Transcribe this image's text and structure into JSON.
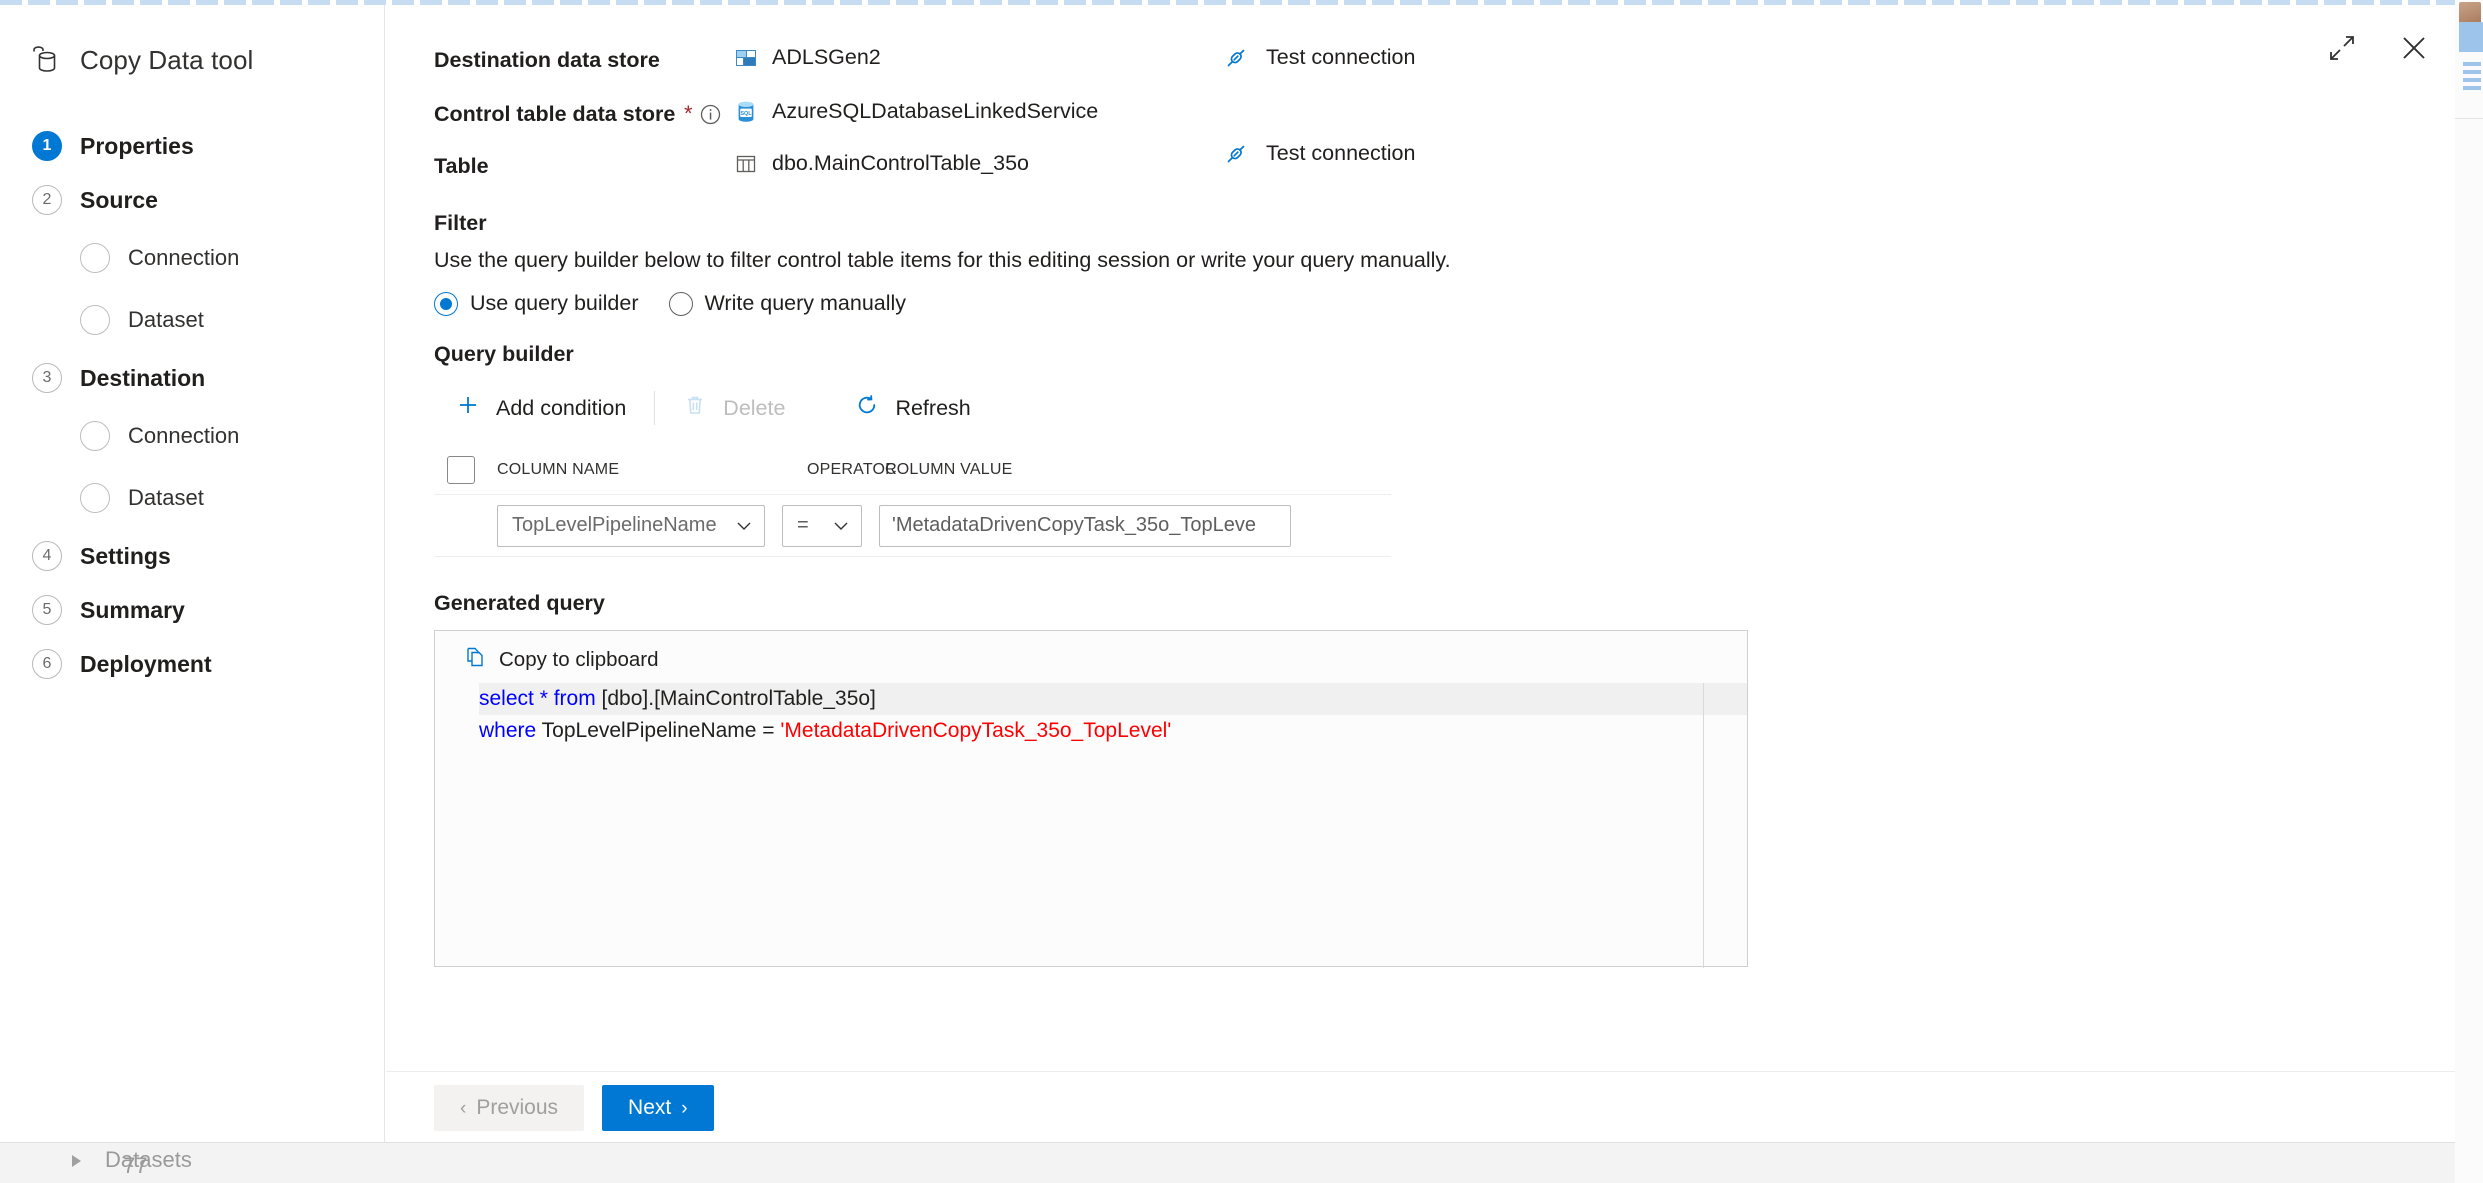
{
  "window": {
    "title": "Copy Data tool",
    "tool_icon": "database-stack-icon",
    "maximize_icon": "expand-diagonal-icon",
    "close_icon": "close-icon"
  },
  "sidebar": {
    "steps": [
      {
        "number": "1",
        "label": "Properties",
        "active": true,
        "substeps": []
      },
      {
        "number": "2",
        "label": "Source",
        "active": false,
        "substeps": [
          "Connection",
          "Dataset"
        ]
      },
      {
        "number": "3",
        "label": "Destination",
        "active": false,
        "substeps": [
          "Connection",
          "Dataset"
        ]
      },
      {
        "number": "4",
        "label": "Settings",
        "active": false,
        "substeps": []
      },
      {
        "number": "5",
        "label": "Summary",
        "active": false,
        "substeps": []
      },
      {
        "number": "6",
        "label": "Deployment",
        "active": false,
        "substeps": []
      }
    ]
  },
  "background": {
    "peek_row_label": "Datasets",
    "peek_row_count": "77",
    "peek_row_chevron": "chevron-right-icon"
  },
  "form": {
    "destination": {
      "label": "Destination data store",
      "value": "ADLSGen2",
      "icon": "adls-gen2-icon",
      "test_connection": "Test connection",
      "test_connection_icon": "plug-connection-icon"
    },
    "control_table_store": {
      "label": "Control table data store",
      "value": "AzureSQLDatabaseLinkedService",
      "icon": "azure-sql-database-icon",
      "required_marker": "*",
      "info_icon": "info-circle-icon",
      "test_connection": "Test connection",
      "test_connection_icon": "plug-connection-icon"
    },
    "table": {
      "label": "Table",
      "value": "dbo.MainControlTable_35o",
      "icon": "table-icon"
    }
  },
  "filter": {
    "heading": "Filter",
    "description": "Use the query builder below to filter control table items for this editing session or write your query manually.",
    "options": [
      {
        "label": "Use query builder",
        "selected": true
      },
      {
        "label": "Write query manually",
        "selected": false
      }
    ]
  },
  "query_builder": {
    "heading": "Query builder",
    "toolbar": {
      "add_condition": "Add condition",
      "add_condition_icon": "plus-icon",
      "delete": "Delete",
      "delete_icon": "trash-icon",
      "delete_disabled": true,
      "refresh": "Refresh",
      "refresh_icon": "refresh-icon"
    },
    "columns": [
      "COLUMN NAME",
      "OPERATOR",
      "COLUMN VALUE"
    ],
    "rows": [
      {
        "column_name": "TopLevelPipelineName",
        "operator": "=",
        "column_value": "'MetadataDrivenCopyTask_35o_TopLeve"
      }
    ]
  },
  "generated_query": {
    "heading": "Generated query",
    "copy_label": "Copy to clipboard",
    "copy_icon": "copy-icon",
    "lines": [
      {
        "keyword": "select",
        "mid": " * ",
        "keyword2": "from",
        "rest": " [dbo].[MainControlTable_35o]",
        "string": "",
        "highlight": true
      },
      {
        "keyword": "where",
        "mid": " TopLevelPipelineName = ",
        "keyword2": "",
        "rest": "",
        "string": "'MetadataDrivenCopyTask_35o_TopLevel'",
        "highlight": false
      }
    ]
  },
  "footer": {
    "previous": "Previous",
    "previous_arrow": "‹",
    "previous_disabled": true,
    "next": "Next",
    "next_arrow": "›"
  },
  "colors": {
    "accent": "#0078d4",
    "required": "#a4262c",
    "keyword": "#0000ff",
    "string": "#ff0000",
    "text": "#201f1e"
  }
}
